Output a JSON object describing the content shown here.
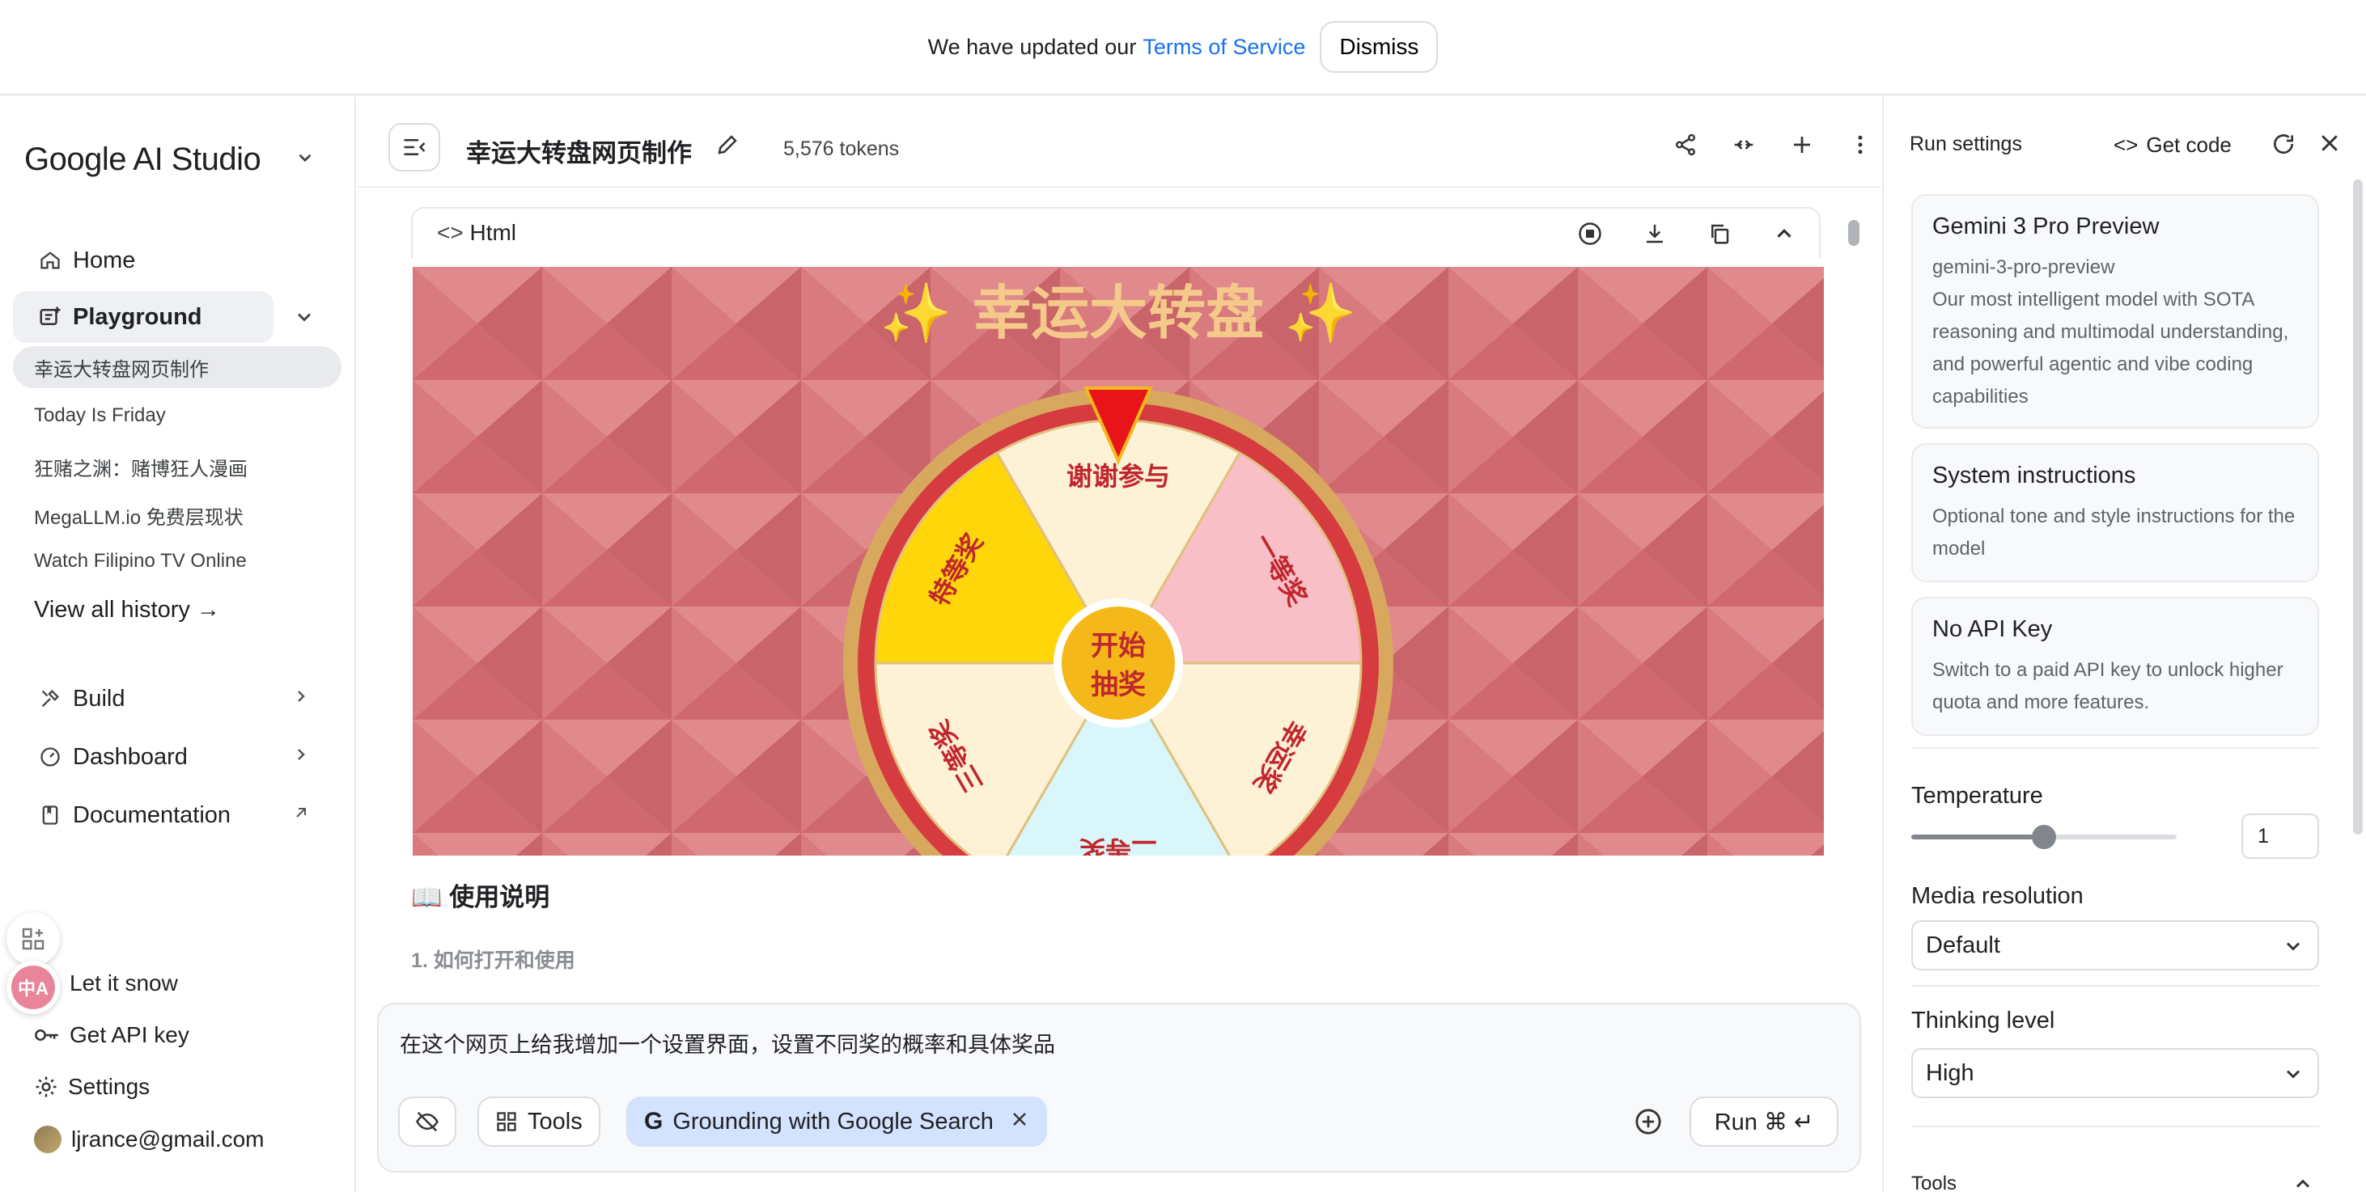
{
  "banner": {
    "text": "We have updated our",
    "link": "Terms of Service",
    "dismiss": "Dismiss"
  },
  "sidebar": {
    "brand": "Google AI Studio",
    "home": "Home",
    "playground": "Playground",
    "history": [
      "幸运大转盘网页制作",
      "Today Is Friday",
      "狂赌之渊：赌博狂人漫画",
      "MegaLLM.io 免费层现状",
      "Watch Filipino TV Online"
    ],
    "view_all": "View all history →",
    "build": "Build",
    "dashboard": "Dashboard",
    "documentation": "Documentation",
    "let_it_snow": "Let it snow",
    "get_api_key": "Get API key",
    "settings": "Settings",
    "user_email": "ljrance@gmail.com"
  },
  "main": {
    "title": "幸运大转盘网页制作",
    "tokens": "5,576 tokens",
    "code_label": "Html",
    "usage_title": "📖 使用说明",
    "usage_sub": "1. 如何打开和使用"
  },
  "preview": {
    "heading": "✨ 幸运大转盘 ✨",
    "center_top": "开始",
    "center_bottom": "抽奖",
    "segments": [
      "谢谢参与",
      "一等奖",
      "幸运奖",
      "二等奖",
      "三等奖",
      "特等奖"
    ]
  },
  "prompt": {
    "text": "在这个网页上给我增加一个设置界面，设置不同奖的概率和具体奖品",
    "tools": "Tools",
    "grounding": "Grounding with Google Search",
    "run": "Run ⌘ ↵"
  },
  "run_settings": {
    "header": "Run settings",
    "get_code": "Get code",
    "model": {
      "name": "Gemini 3 Pro Preview",
      "id": "gemini-3-pro-preview",
      "desc": "Our most intelligent model with SOTA reasoning and multimodal understanding, and powerful agentic and vibe coding capabilities"
    },
    "system": {
      "title": "System instructions",
      "desc": "Optional tone and style instructions for the model"
    },
    "api": {
      "title": "No API Key",
      "desc": "Switch to a paid API key to unlock higher quota and more features."
    },
    "temperature_label": "Temperature",
    "temperature_value": "1",
    "temperature_fraction": 0.5,
    "media_label": "Media resolution",
    "media_value": "Default",
    "thinking_label": "Thinking level",
    "thinking_value": "High",
    "tools_label": "Tools"
  }
}
